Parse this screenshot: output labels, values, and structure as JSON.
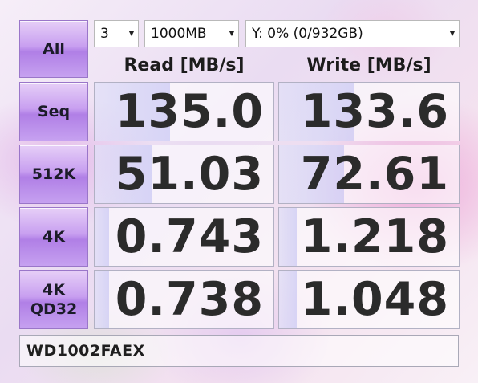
{
  "toolbar": {
    "all_label": "All",
    "count": "3",
    "size": "1000MB",
    "drive": "Y: 0% (0/932GB)"
  },
  "headers": {
    "read": "Read [MB/s]",
    "write": "Write [MB/s]"
  },
  "rows": [
    {
      "label_line1": "Seq",
      "label_line2": "",
      "read": "135.0",
      "write": "133.6"
    },
    {
      "label_line1": "512K",
      "label_line2": "",
      "read": "51.03",
      "write": "72.61"
    },
    {
      "label_line1": "4K",
      "label_line2": "",
      "read": "0.743",
      "write": "1.218"
    },
    {
      "label_line1": "4K",
      "label_line2": "QD32",
      "read": "0.738",
      "write": "1.048"
    }
  ],
  "comment": "WD1002FAEX",
  "icons": {
    "dropdown": "chevron-down-icon"
  }
}
